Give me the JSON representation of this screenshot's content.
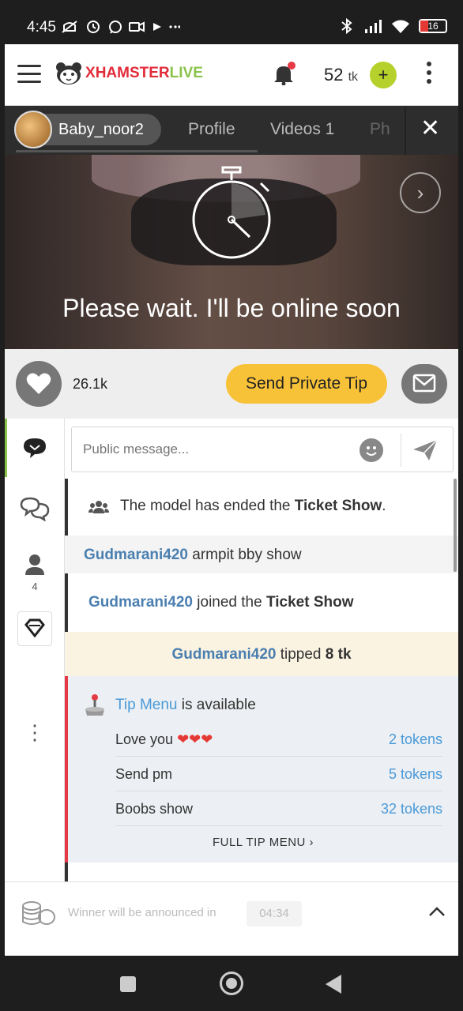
{
  "status_bar": {
    "time": "4:45",
    "battery": "16",
    "battery_color": "#e53935"
  },
  "header": {
    "logo_x": "X",
    "logo_hamster": "HAMSTER",
    "logo_live": "LIVE",
    "token_count": "52",
    "token_unit": "tk",
    "add_label": "+",
    "brand_red": "#e22b3a",
    "brand_green": "#8bc34a"
  },
  "tabs": {
    "model_name": "Baby_noor2",
    "profile": "Profile",
    "videos": "Videos 1",
    "photos": "Ph",
    "close": "✕"
  },
  "video": {
    "message": "Please wait. I'll be online soon",
    "next_icon": "›"
  },
  "actions": {
    "likes": "26.1k",
    "tip_label": "Send Private Tip",
    "tip_color": "#f8c238"
  },
  "rail": {
    "users_count": "4",
    "more": "⋮"
  },
  "chat": {
    "placeholder": "Public message...",
    "system_msg": {
      "before": "The model has ended the ",
      "bold": "Ticket Show",
      "after": "."
    },
    "chat_msg": {
      "user": "Gudmarani420",
      "text": " armpit bby show"
    },
    "join_msg": {
      "user": "Gudmarani420",
      "text": " joined the ",
      "bold": "Ticket Show"
    },
    "tip_msg": {
      "user": "Gudmarani420",
      "text": " tipped ",
      "bold": "8 tk"
    },
    "tip_menu": {
      "link": "Tip Menu",
      "text": " is available",
      "items": [
        {
          "name": "Love you ",
          "hearts": "❤❤❤",
          "price": "2 tokens"
        },
        {
          "name": "Send pm",
          "hearts": "",
          "price": "5 tokens"
        },
        {
          "name": "Boobs show",
          "hearts": "",
          "price": "32 tokens"
        }
      ],
      "full_label": "FULL TIP MENU",
      "full_chevron": "›",
      "accent": "#e53945",
      "link_color": "#4a9ad8"
    }
  },
  "ticker": {
    "text": "Winner will be announced in",
    "time": "04:34",
    "toggle": "^"
  }
}
